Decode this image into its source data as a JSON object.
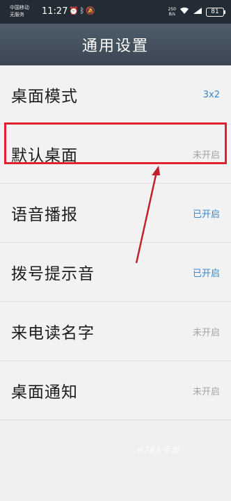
{
  "status_bar": {
    "carrier_line1": "中国移动",
    "carrier_line2": "无服务",
    "time": "11:27",
    "status_icons": [
      "alarm-icon",
      "bluetooth-icon",
      "mute-icon"
    ],
    "speed_value": "250",
    "speed_unit": "B/s",
    "battery": "81"
  },
  "header": {
    "title": "通用设置"
  },
  "settings": [
    {
      "label": "桌面模式",
      "value": "3x2",
      "value_color": "#3a88c8"
    },
    {
      "label": "默认桌面",
      "value": "未开启",
      "value_color": "#a3a3a3"
    },
    {
      "label": "语音播报",
      "value": "已开启",
      "value_color": "#3a88c8"
    },
    {
      "label": "拨号提示音",
      "value": "已开启",
      "value_color": "#3a88c8"
    },
    {
      "label": "来电读名字",
      "value": "未开启",
      "value_color": "#a3a3a3"
    },
    {
      "label": "桌面通知",
      "value": "未开启",
      "value_color": "#a3a3a3"
    }
  ],
  "annotation": {
    "highlight_color": "#e0202a",
    "arrow_color": "#c0202a"
  },
  "watermark": "6765手游"
}
